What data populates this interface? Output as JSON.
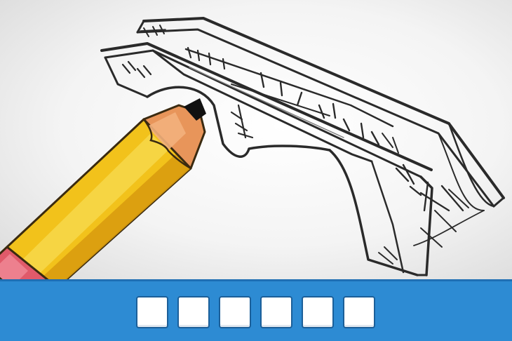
{
  "puzzle": {
    "image_subject": "bridge-drawing",
    "answer_length": 6,
    "slots": [
      "",
      "",
      "",
      "",
      "",
      ""
    ]
  },
  "colors": {
    "answer_bar": "#2d8bd3",
    "slot_fill": "#ffffff",
    "pencil_body": "#f2c21b",
    "pencil_wood": "#e8955a",
    "pencil_eraser": "#e05a6a"
  }
}
